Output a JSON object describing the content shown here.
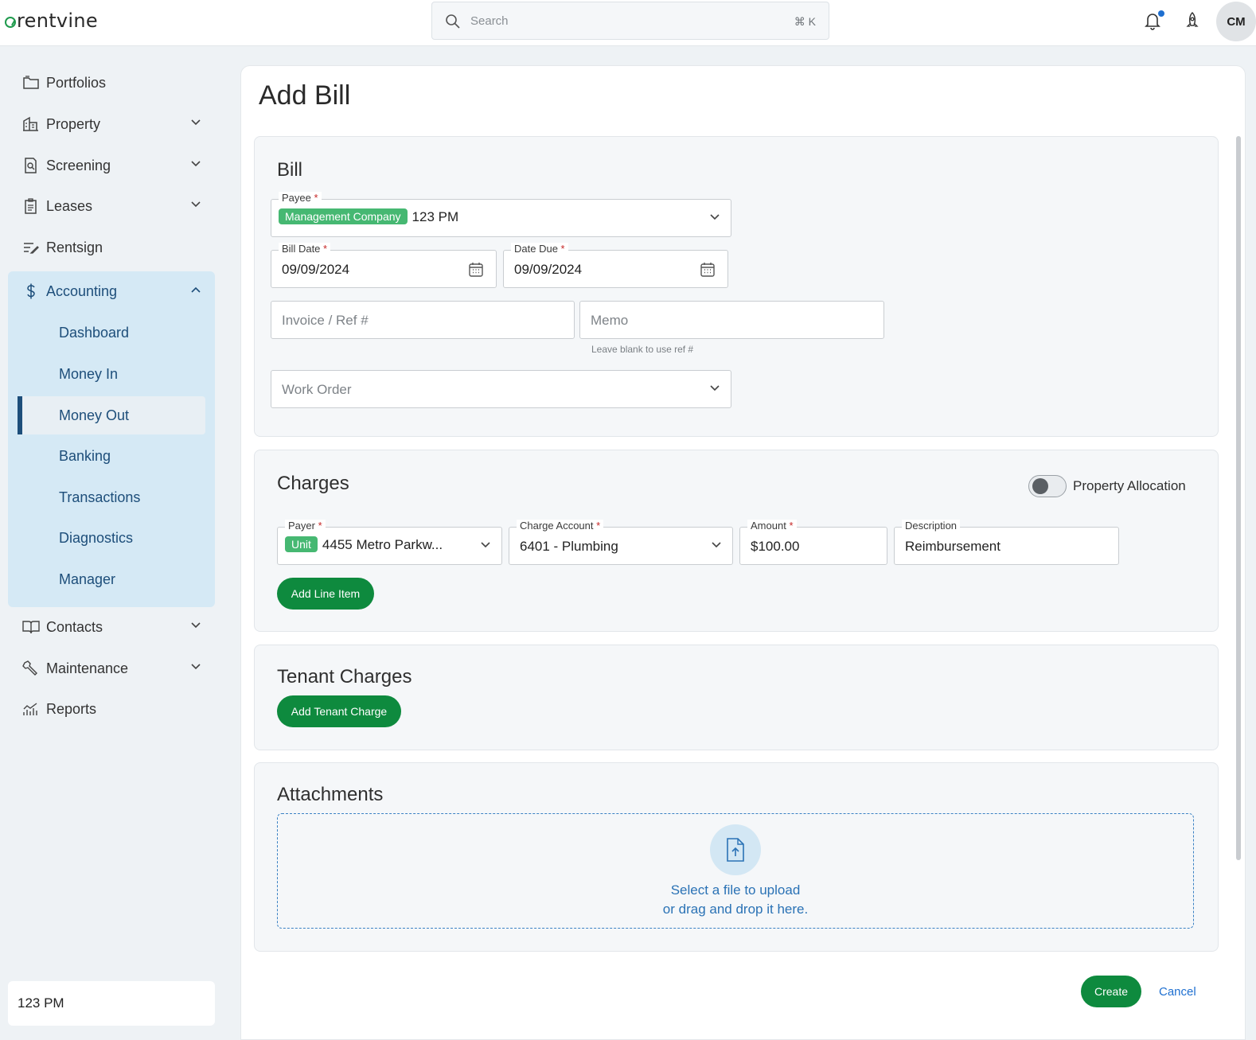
{
  "brand": {
    "name": "rentvine"
  },
  "topbar": {
    "search_placeholder": "Search",
    "search_shortcut": "⌘ K",
    "avatar_initials": "CM"
  },
  "sidebar": {
    "items": [
      {
        "label": "Portfolios",
        "icon": "folder-icon"
      },
      {
        "label": "Property",
        "icon": "building-icon"
      },
      {
        "label": "Screening",
        "icon": "search-document-icon"
      },
      {
        "label": "Leases",
        "icon": "clipboard-icon"
      },
      {
        "label": "Rentsign",
        "icon": "sign-icon"
      },
      {
        "label": "Accounting",
        "icon": "dollar-icon"
      },
      {
        "label": "Contacts",
        "icon": "book-icon"
      },
      {
        "label": "Maintenance",
        "icon": "wrench-icon"
      },
      {
        "label": "Reports",
        "icon": "chart-icon"
      }
    ],
    "accounting_sub": [
      "Dashboard",
      "Money In",
      "Money Out",
      "Banking",
      "Transactions",
      "Diagnostics",
      "Manager"
    ],
    "active_sub": "Money Out",
    "portfolio": "123 PM"
  },
  "page": {
    "title": "Add Bill"
  },
  "bill": {
    "title": "Bill",
    "payee_label": "Payee",
    "payee_chip": "Management Company",
    "payee_value": "123 PM",
    "bill_date_label": "Bill Date",
    "bill_date_value": "09/09/2024",
    "date_due_label": "Date Due",
    "date_due_value": "09/09/2024",
    "invoice_placeholder": "Invoice / Ref #",
    "memo_placeholder": "Memo",
    "memo_hint": "Leave blank to use ref #",
    "work_order_placeholder": "Work Order"
  },
  "charges": {
    "title": "Charges",
    "property_allocation_label": "Property Allocation",
    "property_allocation_on": false,
    "payer_label": "Payer",
    "payer_chip": "Unit",
    "payer_value": "4455 Metro Parkw...",
    "charge_account_label": "Charge Account",
    "charge_account_value": "6401 - Plumbing",
    "amount_label": "Amount",
    "amount_value": "$100.00",
    "description_label": "Description",
    "description_value": "Reimbursement",
    "add_line_item": "Add Line Item"
  },
  "tenant_charges": {
    "title": "Tenant Charges",
    "add_button": "Add Tenant Charge"
  },
  "attachments": {
    "title": "Attachments",
    "line1": "Select a file to upload",
    "line2": "or drag and drop it here."
  },
  "actions": {
    "create": "Create",
    "cancel": "Cancel"
  },
  "colors": {
    "primary_green": "#0e8a3e",
    "chip_green": "#46b872",
    "accent_blue": "#1e6fd0",
    "accounting_bg": "#d5e9f5",
    "required_red": "#c62828"
  }
}
